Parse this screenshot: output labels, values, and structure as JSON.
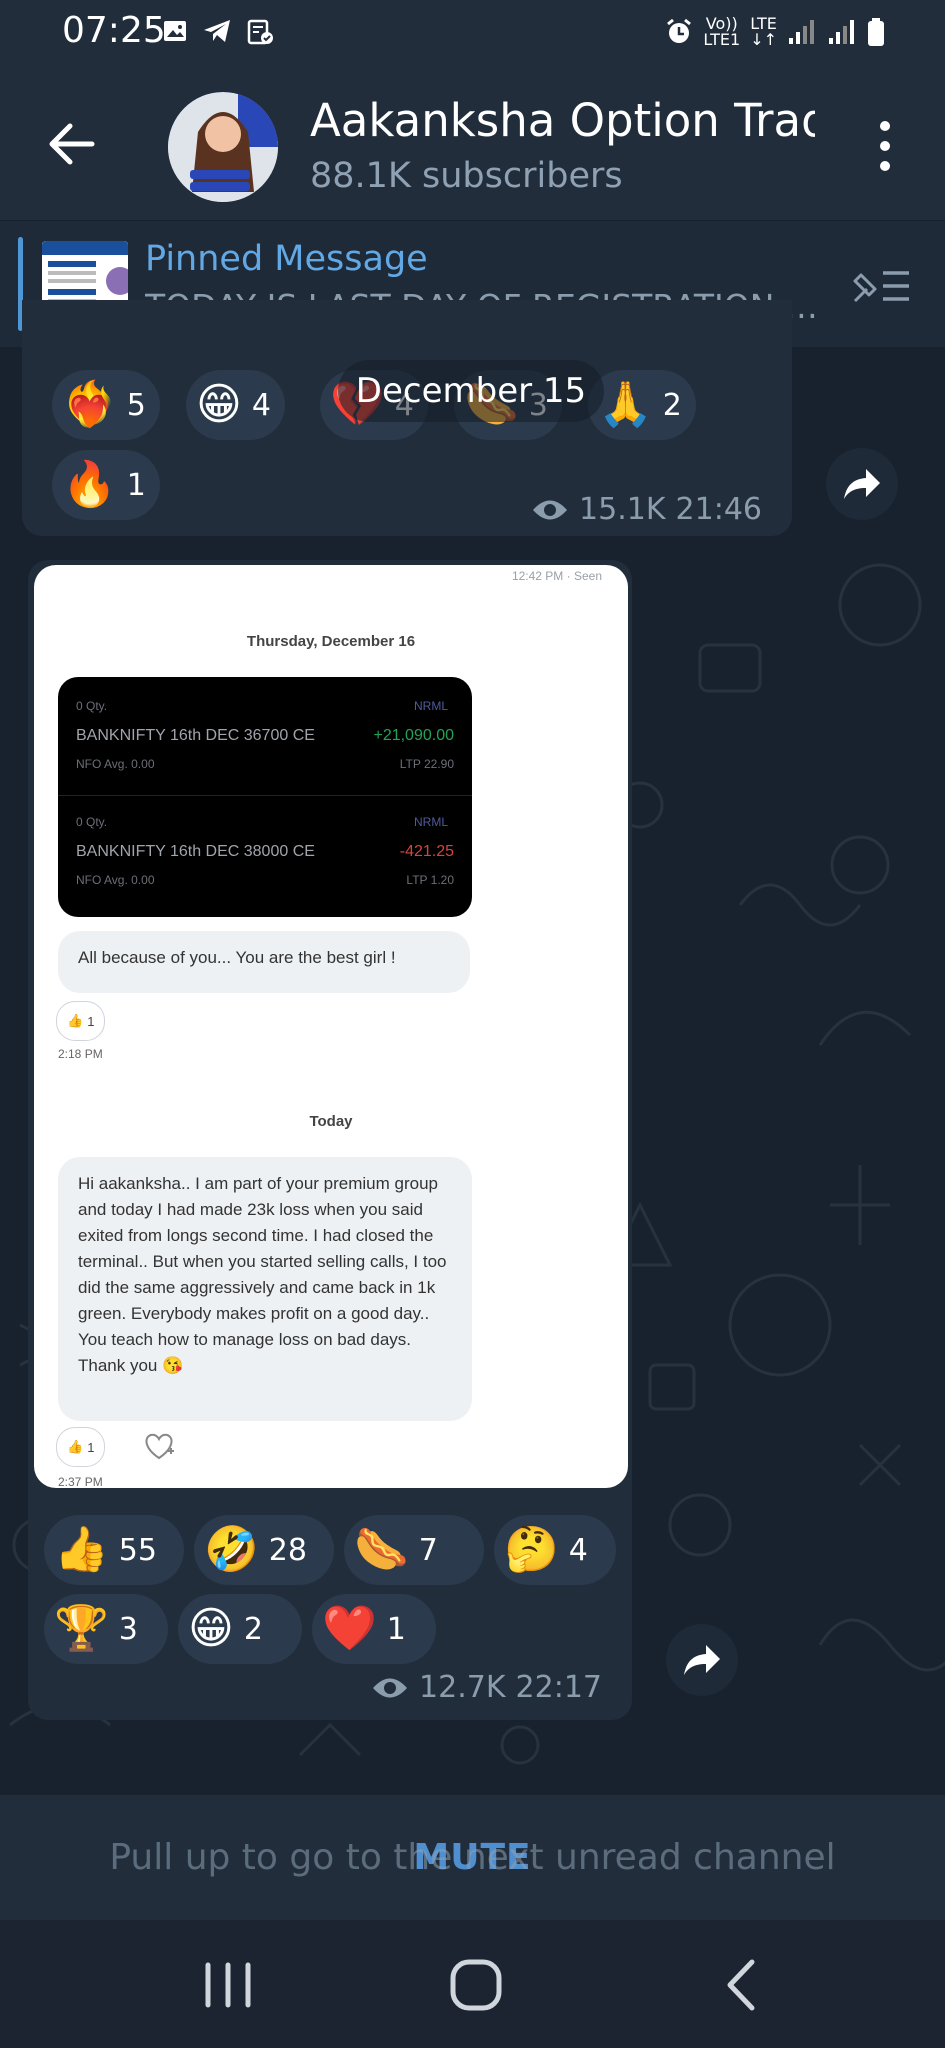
{
  "status_bar": {
    "time": "07:25",
    "network_top": "Vo))",
    "network_bottom": "LTE1",
    "lte_top": "LTE",
    "lte_bottom": "↓↑"
  },
  "header": {
    "title": "Aakanksha Option Tradi",
    "subscribers": "88.1K subscribers"
  },
  "pinned": {
    "label": "Pinned Message",
    "text": "TODAY IS LAST DAY OF REGISTRATION (a..."
  },
  "floating_date": "December 15",
  "message_1": {
    "reactions": [
      {
        "emoji": "❤️‍🔥",
        "count": "5"
      },
      {
        "emoji": "😁",
        "count": "4"
      },
      {
        "emoji": "💔",
        "count": "4"
      },
      {
        "emoji": "🌭",
        "count": "3"
      },
      {
        "emoji": "🙏",
        "count": "2"
      },
      {
        "emoji": "🔥",
        "count": "1"
      }
    ],
    "views": "15.1K",
    "time": "21:46"
  },
  "screenshot": {
    "top_time": "12:42 PM · Seen",
    "day_1": "Thursday, December 16",
    "positions": [
      {
        "qty": "0 Qty.",
        "name": "BANKNIFTY 16th  DEC 36700 CE",
        "avg": "NFO  Avg. 0.00",
        "tag": "NRML",
        "pnl": "+21,090.00",
        "ltp": "LTP 22.90",
        "pnl_color": "#23a356"
      },
      {
        "qty": "0 Qty.",
        "name": "BANKNIFTY 16th  DEC 38000 CE",
        "avg": "NFO  Avg. 0.00",
        "tag": "NRML",
        "pnl": "-421.25",
        "ltp": "LTP 1.20",
        "pnl_color": "#d6453a"
      }
    ],
    "message_short": "All because of you... You are the best girl !",
    "like_count_1": "1",
    "time_1": "2:18 PM",
    "day_2": "Today",
    "message_long": "Hi aakanksha.. I am part of your premium group and today I had made 23k loss when you said exited from longs second time. I had closed the terminal.. But when you started selling calls, I too did the same aggressively and came back in 1k green. Everybody makes profit on a good day.. You teach how to manage loss on bad days. Thank you 😘",
    "like_count_2": "1",
    "time_2": "2:37 PM"
  },
  "message_2": {
    "reactions": [
      {
        "emoji": "👍",
        "count": "55"
      },
      {
        "emoji": "🤣",
        "count": "28"
      },
      {
        "emoji": "🌭",
        "count": "7"
      },
      {
        "emoji": "🤔",
        "count": "4"
      },
      {
        "emoji": "🏆",
        "count": "3"
      },
      {
        "emoji": "😁",
        "count": "2"
      },
      {
        "emoji": "❤️",
        "count": "1"
      }
    ],
    "views": "12.7K",
    "time": "22:17"
  },
  "bottom": {
    "mute_label": "MUTE",
    "pull_hint": "Pull up to go to the next unread channel"
  },
  "colors": {
    "accent": "#62a8e5",
    "header_bg": "#212d3b",
    "chat_bg": "#18222e"
  }
}
